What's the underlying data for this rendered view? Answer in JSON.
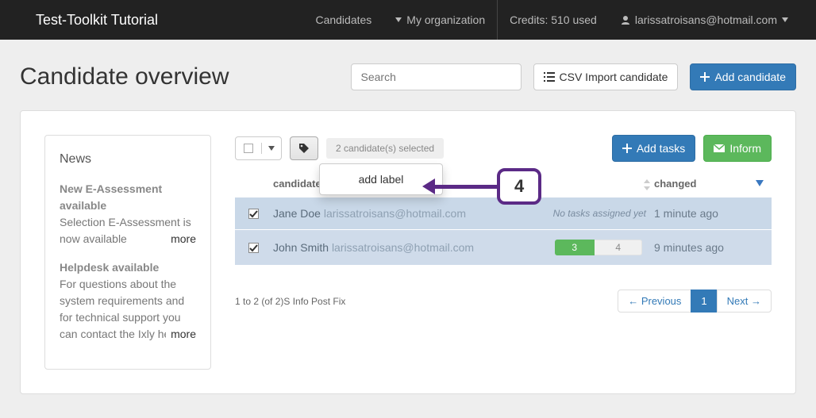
{
  "navbar": {
    "brand": "Test-Toolkit Tutorial",
    "candidates": "Candidates",
    "my_org": "My organization",
    "credits": "Credits: 510 used",
    "user": "larissatroisans@hotmail.com"
  },
  "header": {
    "title": "Candidate overview",
    "search_placeholder": "Search",
    "csv_import": "CSV Import candidate",
    "add_candidate": "Add candidate"
  },
  "news": {
    "heading": "News",
    "items": [
      {
        "title": "New E-Assessment available",
        "body": "Selection E-Assessment is now available",
        "more": "more"
      },
      {
        "title": "Helpdesk available",
        "body": "For questions about the system requirements and for technical support you can contact the Ixly he...",
        "more": "more"
      }
    ]
  },
  "toolbar": {
    "selected_label": "2 candidate(s) selected",
    "add_label_dropdown": "add label",
    "add_tasks": "Add tasks",
    "inform": "Inform"
  },
  "table": {
    "col_candidate": "candidate",
    "col_changed": "changed",
    "rows": [
      {
        "checked": true,
        "name": "Jane Doe",
        "email": "larissatroisans@hotmail.com",
        "no_tasks_label": "No tasks assigned yet",
        "changed": "1 minute ago"
      },
      {
        "checked": true,
        "name": "John Smith",
        "email": "larissatroisans@hotmail.com",
        "done": "3",
        "total": "4",
        "changed": "9 minutes ago"
      }
    ]
  },
  "footer": {
    "range": "1 to 2 (of 2)S Info Post Fix",
    "prev": "← Previous",
    "page": "1",
    "next": "Next →"
  },
  "callout": {
    "number": "4"
  }
}
